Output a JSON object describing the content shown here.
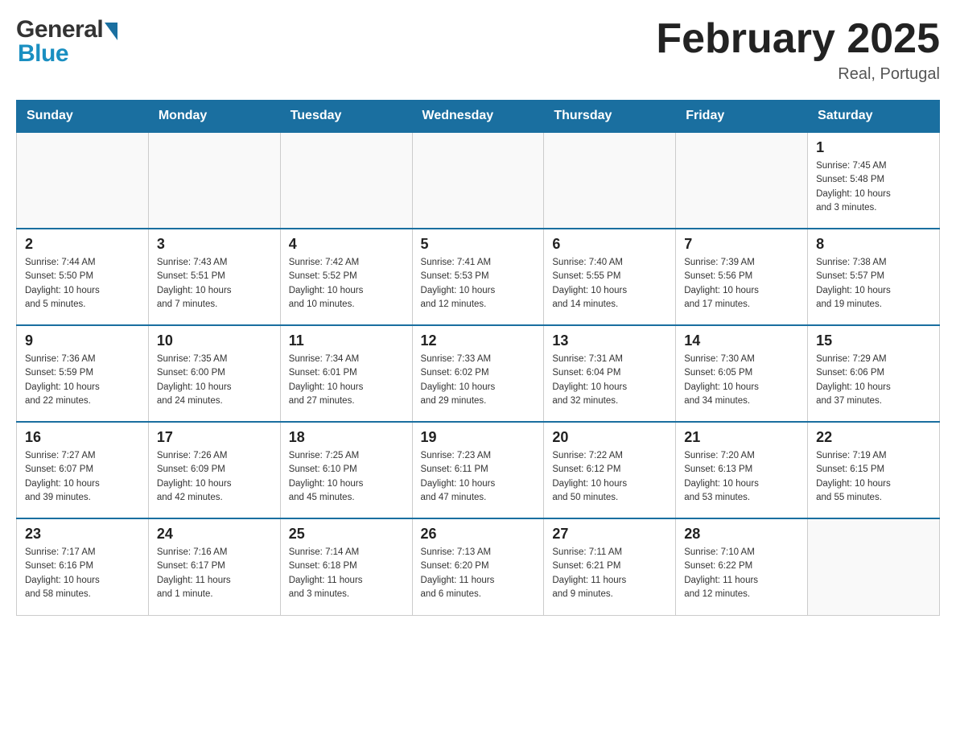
{
  "header": {
    "logo_general": "General",
    "logo_blue": "Blue",
    "month_title": "February 2025",
    "location": "Real, Portugal"
  },
  "weekdays": [
    "Sunday",
    "Monday",
    "Tuesday",
    "Wednesday",
    "Thursday",
    "Friday",
    "Saturday"
  ],
  "weeks": [
    [
      {
        "day": "",
        "info": ""
      },
      {
        "day": "",
        "info": ""
      },
      {
        "day": "",
        "info": ""
      },
      {
        "day": "",
        "info": ""
      },
      {
        "day": "",
        "info": ""
      },
      {
        "day": "",
        "info": ""
      },
      {
        "day": "1",
        "info": "Sunrise: 7:45 AM\nSunset: 5:48 PM\nDaylight: 10 hours\nand 3 minutes."
      }
    ],
    [
      {
        "day": "2",
        "info": "Sunrise: 7:44 AM\nSunset: 5:50 PM\nDaylight: 10 hours\nand 5 minutes."
      },
      {
        "day": "3",
        "info": "Sunrise: 7:43 AM\nSunset: 5:51 PM\nDaylight: 10 hours\nand 7 minutes."
      },
      {
        "day": "4",
        "info": "Sunrise: 7:42 AM\nSunset: 5:52 PM\nDaylight: 10 hours\nand 10 minutes."
      },
      {
        "day": "5",
        "info": "Sunrise: 7:41 AM\nSunset: 5:53 PM\nDaylight: 10 hours\nand 12 minutes."
      },
      {
        "day": "6",
        "info": "Sunrise: 7:40 AM\nSunset: 5:55 PM\nDaylight: 10 hours\nand 14 minutes."
      },
      {
        "day": "7",
        "info": "Sunrise: 7:39 AM\nSunset: 5:56 PM\nDaylight: 10 hours\nand 17 minutes."
      },
      {
        "day": "8",
        "info": "Sunrise: 7:38 AM\nSunset: 5:57 PM\nDaylight: 10 hours\nand 19 minutes."
      }
    ],
    [
      {
        "day": "9",
        "info": "Sunrise: 7:36 AM\nSunset: 5:59 PM\nDaylight: 10 hours\nand 22 minutes."
      },
      {
        "day": "10",
        "info": "Sunrise: 7:35 AM\nSunset: 6:00 PM\nDaylight: 10 hours\nand 24 minutes."
      },
      {
        "day": "11",
        "info": "Sunrise: 7:34 AM\nSunset: 6:01 PM\nDaylight: 10 hours\nand 27 minutes."
      },
      {
        "day": "12",
        "info": "Sunrise: 7:33 AM\nSunset: 6:02 PM\nDaylight: 10 hours\nand 29 minutes."
      },
      {
        "day": "13",
        "info": "Sunrise: 7:31 AM\nSunset: 6:04 PM\nDaylight: 10 hours\nand 32 minutes."
      },
      {
        "day": "14",
        "info": "Sunrise: 7:30 AM\nSunset: 6:05 PM\nDaylight: 10 hours\nand 34 minutes."
      },
      {
        "day": "15",
        "info": "Sunrise: 7:29 AM\nSunset: 6:06 PM\nDaylight: 10 hours\nand 37 minutes."
      }
    ],
    [
      {
        "day": "16",
        "info": "Sunrise: 7:27 AM\nSunset: 6:07 PM\nDaylight: 10 hours\nand 39 minutes."
      },
      {
        "day": "17",
        "info": "Sunrise: 7:26 AM\nSunset: 6:09 PM\nDaylight: 10 hours\nand 42 minutes."
      },
      {
        "day": "18",
        "info": "Sunrise: 7:25 AM\nSunset: 6:10 PM\nDaylight: 10 hours\nand 45 minutes."
      },
      {
        "day": "19",
        "info": "Sunrise: 7:23 AM\nSunset: 6:11 PM\nDaylight: 10 hours\nand 47 minutes."
      },
      {
        "day": "20",
        "info": "Sunrise: 7:22 AM\nSunset: 6:12 PM\nDaylight: 10 hours\nand 50 minutes."
      },
      {
        "day": "21",
        "info": "Sunrise: 7:20 AM\nSunset: 6:13 PM\nDaylight: 10 hours\nand 53 minutes."
      },
      {
        "day": "22",
        "info": "Sunrise: 7:19 AM\nSunset: 6:15 PM\nDaylight: 10 hours\nand 55 minutes."
      }
    ],
    [
      {
        "day": "23",
        "info": "Sunrise: 7:17 AM\nSunset: 6:16 PM\nDaylight: 10 hours\nand 58 minutes."
      },
      {
        "day": "24",
        "info": "Sunrise: 7:16 AM\nSunset: 6:17 PM\nDaylight: 11 hours\nand 1 minute."
      },
      {
        "day": "25",
        "info": "Sunrise: 7:14 AM\nSunset: 6:18 PM\nDaylight: 11 hours\nand 3 minutes."
      },
      {
        "day": "26",
        "info": "Sunrise: 7:13 AM\nSunset: 6:20 PM\nDaylight: 11 hours\nand 6 minutes."
      },
      {
        "day": "27",
        "info": "Sunrise: 7:11 AM\nSunset: 6:21 PM\nDaylight: 11 hours\nand 9 minutes."
      },
      {
        "day": "28",
        "info": "Sunrise: 7:10 AM\nSunset: 6:22 PM\nDaylight: 11 hours\nand 12 minutes."
      },
      {
        "day": "",
        "info": ""
      }
    ]
  ]
}
